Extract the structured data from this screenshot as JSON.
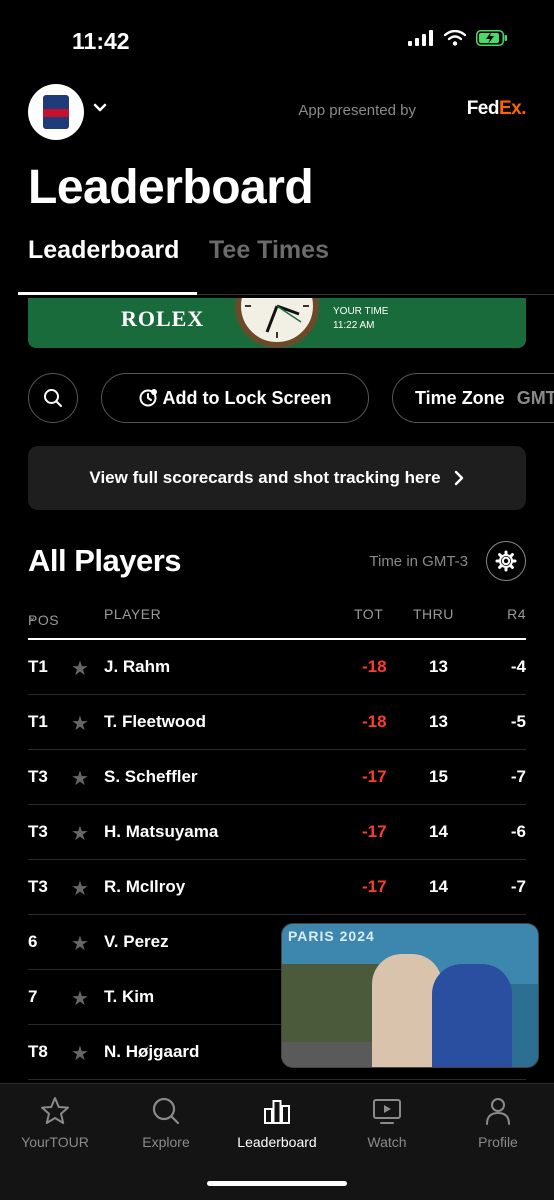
{
  "status_bar": {
    "time": "11:42"
  },
  "header": {
    "presented_by": "App presented by",
    "sponsor_fed": "Fed",
    "sponsor_ex": "Ex."
  },
  "page_title": "Leaderboard",
  "tabs": [
    {
      "label": "Leaderboard",
      "active": true
    },
    {
      "label": "Tee Times",
      "active": false
    }
  ],
  "rolex": {
    "brand": "ROLEX",
    "your_time_label": "YOUR TIME",
    "your_time_value": "11:22 AM"
  },
  "actions": {
    "add_lock_screen": "Add to Lock Screen",
    "time_zone_label": "Time Zone",
    "time_zone_value": "GMT"
  },
  "scorecard_banner": "View full scorecards and shot tracking here",
  "section": {
    "title": "All Players",
    "time_in": "Time in GMT-3"
  },
  "table": {
    "headers": {
      "pos": "POS",
      "player": "PLAYER",
      "tot": "TOT",
      "thru": "THRU",
      "r4": "R4"
    },
    "rows": [
      {
        "pos": "T1",
        "player": "J. Rahm",
        "tot": "-18",
        "thru": "13",
        "r4": "-4"
      },
      {
        "pos": "T1",
        "player": "T. Fleetwood",
        "tot": "-18",
        "thru": "13",
        "r4": "-5"
      },
      {
        "pos": "T3",
        "player": "S. Scheffler",
        "tot": "-17",
        "thru": "15",
        "r4": "-7"
      },
      {
        "pos": "T3",
        "player": "H. Matsuyama",
        "tot": "-17",
        "thru": "14",
        "r4": "-6"
      },
      {
        "pos": "T3",
        "player": "R. McIlroy",
        "tot": "-17",
        "thru": "14",
        "r4": "-7"
      },
      {
        "pos": "6",
        "player": "V. Perez",
        "tot": "",
        "thru": "",
        "r4": ""
      },
      {
        "pos": "7",
        "player": "T. Kim",
        "tot": "",
        "thru": "",
        "r4": ""
      },
      {
        "pos": "T8",
        "player": "N. Højgaard",
        "tot": "",
        "thru": "",
        "r4": ""
      }
    ]
  },
  "video_pip": {
    "overlay_text": "PARIS 2024"
  },
  "bottom_nav": [
    {
      "label": "YourTOUR",
      "icon": "star-icon"
    },
    {
      "label": "Explore",
      "icon": "search-icon"
    },
    {
      "label": "Leaderboard",
      "icon": "leaderboard-icon",
      "active": true
    },
    {
      "label": "Watch",
      "icon": "watch-icon"
    },
    {
      "label": "Profile",
      "icon": "profile-icon"
    }
  ],
  "colors": {
    "negative_score": "#ff3b30",
    "rolex_green": "#1a6b3c",
    "fedex_orange": "#ff6200",
    "background": "#000000"
  }
}
